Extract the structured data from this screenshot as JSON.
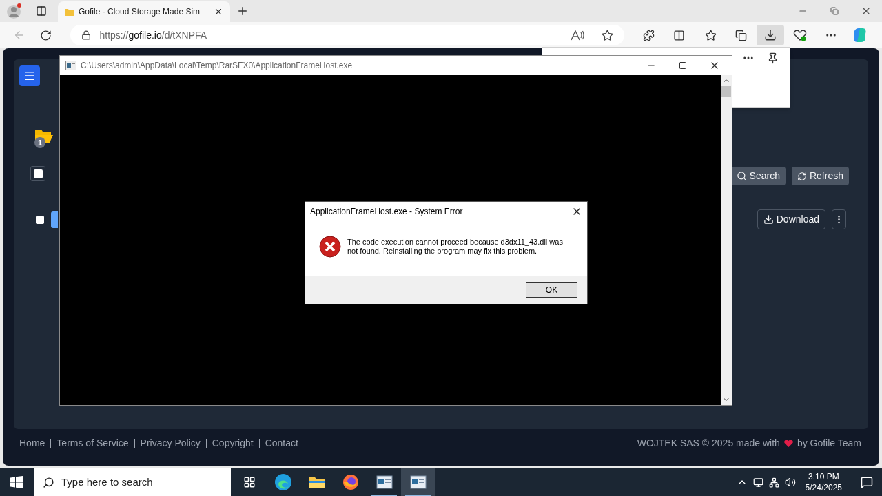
{
  "browser": {
    "tab": {
      "title": "Gofile - Cloud Storage Made Sim",
      "selected": true
    },
    "url_host": "gofile.io",
    "url_prefix": "https://",
    "url_path": "/d/tXNPFA"
  },
  "page": {
    "folder_badge": "1",
    "select_all": {
      "checked": false
    },
    "toolbar_buttons": [
      {
        "kind": "search",
        "label": "Search"
      },
      {
        "kind": "refresh",
        "label": "Refresh"
      }
    ],
    "file": {
      "checked": false,
      "download_label": "Download"
    },
    "footer_links": [
      "Home",
      "Terms of Service",
      "Privacy Policy",
      "Copyright",
      "Contact"
    ],
    "footer_credit_start": "WOJTEK SAS © 2025 made with",
    "footer_credit_end": "by Gofile Team"
  },
  "console_window": {
    "title": "C:\\Users\\admin\\AppData\\Local\\Temp\\RarSFX0\\ApplicationFrameHost.exe"
  },
  "error_dialog": {
    "title": "ApplicationFrameHost.exe - System Error",
    "message": "The code execution cannot proceed because d3dx11_43.dll was not found. Reinstalling the program may fix this problem.",
    "button": "OK"
  },
  "taskbar": {
    "search_placeholder": "Type here to search",
    "apps": [
      {
        "kind": "taskview",
        "selected": false
      },
      {
        "kind": "edge",
        "selected": false
      },
      {
        "kind": "explorer",
        "selected": false
      },
      {
        "kind": "firefox",
        "selected": false
      },
      {
        "kind": "window",
        "selected": false
      },
      {
        "kind": "window",
        "selected": true
      }
    ],
    "time": "3:10 PM",
    "date": "5/24/2025"
  }
}
